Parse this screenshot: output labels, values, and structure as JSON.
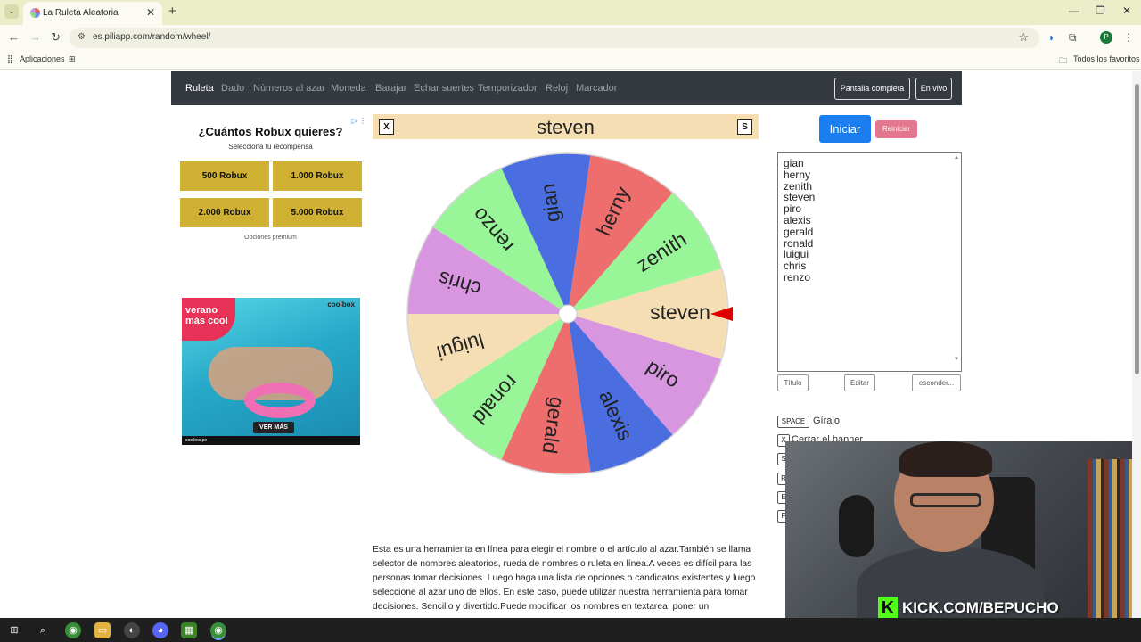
{
  "browser": {
    "tab_title": "La Ruleta Aleatoria",
    "url": "es.piliapp.com/random/wheel/",
    "profile_initial": "P",
    "bookmarks": {
      "apps": "Aplicaciones",
      "favorites": "Todos los favoritos"
    }
  },
  "nav": {
    "items": [
      "Ruleta",
      "Dado",
      "Números al azar",
      "Moneda",
      "Barajar",
      "Echar suertes",
      "Temporizador",
      "Reloj",
      "Marcador"
    ],
    "fullscreen": "Pantalla completa",
    "live": "En vivo"
  },
  "ad_robux": {
    "title": "¿Cuántos Robux quieres?",
    "subtitle": "Selecciona tu recompensa",
    "options": [
      "500 Robux",
      "1.000 Robux",
      "2.000 Robux",
      "5.000 Robux"
    ],
    "footer": "Opciones premium"
  },
  "ad_pool": {
    "logo_line1": "verano",
    "logo_line2": "más cool",
    "brand": "coolbox",
    "cta": "VER MÁS",
    "footer": "coolbox.pe"
  },
  "banner": {
    "close_key": "X",
    "selected": "steven",
    "s_key": "S"
  },
  "wheel": {
    "segments": [
      {
        "name": "gian",
        "color": "#4a6ee0"
      },
      {
        "name": "herny",
        "color": "#ee6e6e"
      },
      {
        "name": "zenith",
        "color": "#98f598"
      },
      {
        "name": "steven",
        "color": "#f5deb3"
      },
      {
        "name": "piro",
        "color": "#d896e0"
      },
      {
        "name": "alexis",
        "color": "#4a6ee0"
      },
      {
        "name": "gerald",
        "color": "#ee6e6e"
      },
      {
        "name": "ronald",
        "color": "#98f598"
      },
      {
        "name": "luigui",
        "color": "#f5deb3"
      },
      {
        "name": "chris",
        "color": "#d896e0"
      },
      {
        "name": "renzo",
        "color": "#98f598"
      }
    ],
    "pointer_color": "#e00000"
  },
  "controls": {
    "start": "Iniciar",
    "reset": "Reiniciar",
    "names": [
      "gian",
      "herny",
      "zenith",
      "steven",
      "piro",
      "alexis",
      "gerald",
      "ronald",
      "luigui",
      "chris",
      "renzo"
    ],
    "title_btn": "Título",
    "edit_btn": "Editar",
    "hide_btn": "esconder..."
  },
  "shortcuts": [
    {
      "key": "SPACE",
      "label": "Gíralo"
    },
    {
      "key": "X",
      "label": "Cerrar el banner"
    },
    {
      "key": "S",
      "label": ""
    },
    {
      "key": "R",
      "label": ""
    },
    {
      "key": "E",
      "label": ""
    },
    {
      "key": "F",
      "label": ""
    }
  ],
  "description": "Esta es una herramienta en línea para elegir el nombre o el artículo al azar.También se llama selector de nombres aleatorios, rueda de nombres o ruleta en línea.A veces es difícil para las personas tomar decisiones. Luego haga una lista de opciones o candidatos existentes y luego seleccione al azar uno de ellos. En este caso, puede utilizar nuestra herramienta para tomar decisiones. Sencillo y divertido.Puede modificar los nombres en textarea, poner un",
  "webcam": {
    "overlay": "KICK.COM/BEPUCHO"
  }
}
